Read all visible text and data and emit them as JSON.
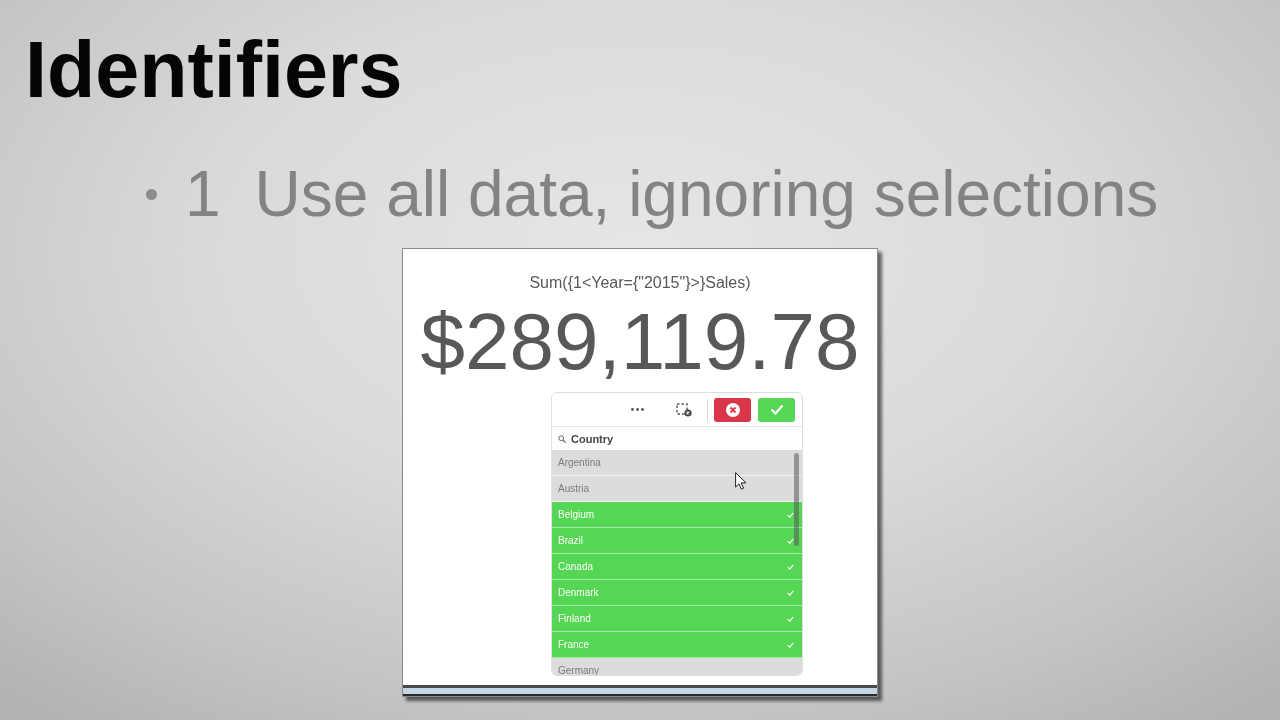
{
  "slide": {
    "title": "Identifiers",
    "bullet": {
      "number": "1",
      "text": "Use all data, ignoring selections"
    }
  },
  "kpi": {
    "title": "Sum({1<Year={\"2015\"}>}Sales)",
    "value": "$289,119.78"
  },
  "listbox": {
    "title": "Country",
    "items": [
      {
        "label": "Argentina",
        "selected": false
      },
      {
        "label": "Austria",
        "selected": false
      },
      {
        "label": "Belgium",
        "selected": true
      },
      {
        "label": "Brazil",
        "selected": true
      },
      {
        "label": "Canada",
        "selected": true
      },
      {
        "label": "Denmark",
        "selected": true
      },
      {
        "label": "Finland",
        "selected": true
      },
      {
        "label": "France",
        "selected": true
      },
      {
        "label": "Germany",
        "selected": false
      }
    ]
  }
}
